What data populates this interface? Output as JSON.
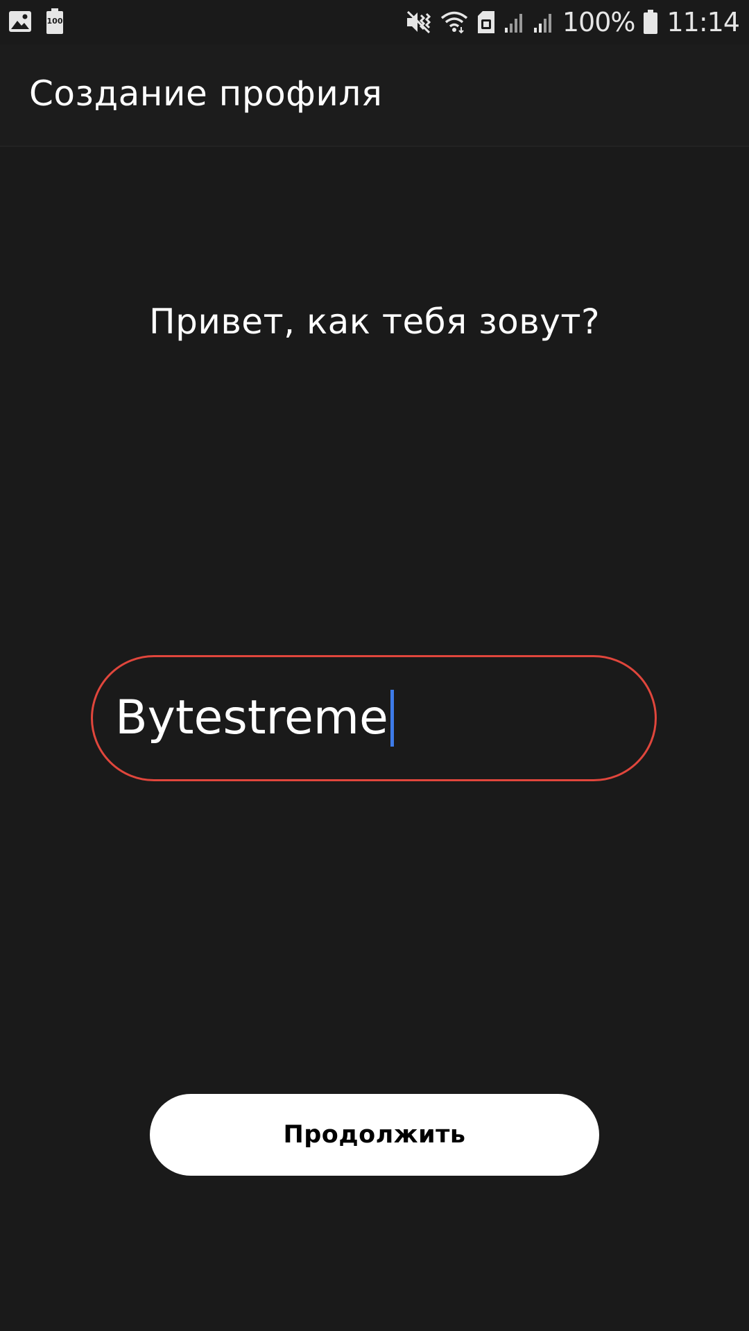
{
  "status_bar": {
    "left_icons": [
      "image-icon",
      "battery-saver-100-icon"
    ],
    "battery_saver_label": "100",
    "right_icons": [
      "mute-vibrate-icon",
      "wifi-icon",
      "sim-icon",
      "signal-1-icon",
      "signal-2-icon",
      "battery-icon"
    ],
    "battery_percent": "100%",
    "time": "11:14"
  },
  "app_bar": {
    "title": "Создание профиля"
  },
  "main": {
    "greeting": "Привет, как тебя зовут?",
    "name_input": {
      "value": "Bytestreme",
      "border_color": "#e0463c",
      "caret_color": "#3d7be8"
    },
    "continue_label": "Продолжить"
  },
  "colors": {
    "background": "#1a1a1a",
    "button_bg": "#ffffff",
    "button_text": "#000000"
  }
}
